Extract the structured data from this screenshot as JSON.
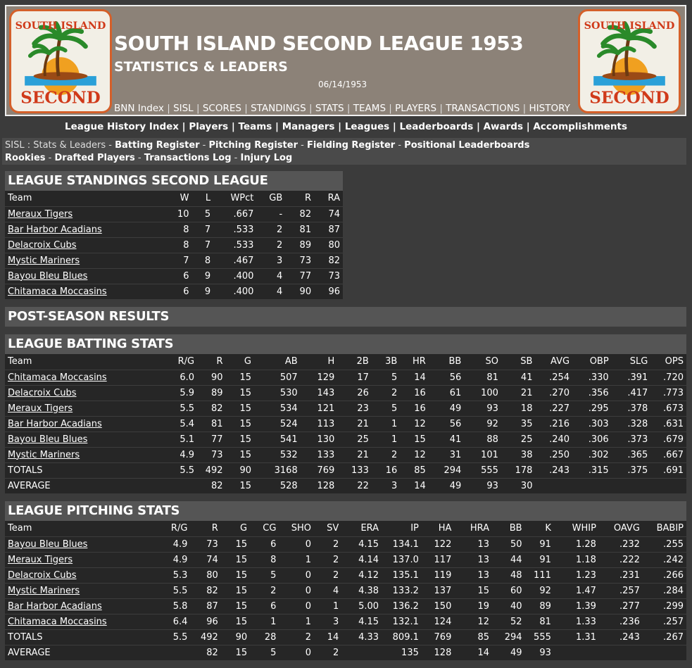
{
  "header": {
    "title": "SOUTH ISLAND SECOND LEAGUE 1953",
    "subtitle": "STATISTICS & LEADERS",
    "date": "06/14/1953",
    "logo_top_text": "SOUTH ISLAND",
    "logo_bottom_text": "SECOND",
    "nav": [
      "BNN Index",
      "SISL",
      "SCORES",
      "STANDINGS",
      "STATS",
      "TEAMS",
      "PLAYERS",
      "TRANSACTIONS",
      "HISTORY"
    ]
  },
  "history_nav": [
    "League History Index",
    "Players",
    "Teams",
    "Managers",
    "Leagues",
    "Leaderboards",
    "Awards",
    "Accomplishments"
  ],
  "stats_nav": {
    "prefix": "SISL : Stats & Leaders - ",
    "links": [
      "Batting Register",
      "Pitching Register",
      "Fielding Register",
      "Positional Leaderboards",
      "Rookies",
      "Drafted Players",
      "Transactions Log",
      "Injury Log"
    ]
  },
  "standings": {
    "title": "LEAGUE STANDINGS SECOND LEAGUE",
    "columns": [
      "Team",
      "W",
      "L",
      "WPct",
      "GB",
      "R",
      "RA"
    ],
    "rows": [
      [
        "Meraux Tigers",
        "10",
        "5",
        ".667",
        "-",
        "82",
        "74"
      ],
      [
        "Bar Harbor Acadians",
        "8",
        "7",
        ".533",
        "2",
        "81",
        "87"
      ],
      [
        "Delacroix Cubs",
        "8",
        "7",
        ".533",
        "2",
        "89",
        "80"
      ],
      [
        "Mystic Mariners",
        "7",
        "8",
        ".467",
        "3",
        "73",
        "82"
      ],
      [
        "Bayou Bleu Blues",
        "6",
        "9",
        ".400",
        "4",
        "77",
        "73"
      ],
      [
        "Chitamaca Moccasins",
        "6",
        "9",
        ".400",
        "4",
        "90",
        "96"
      ]
    ]
  },
  "postseason": {
    "title": "POST-SEASON RESULTS"
  },
  "batting": {
    "title": "LEAGUE BATTING STATS",
    "columns": [
      "Team",
      "R/G",
      "R",
      "G",
      "AB",
      "H",
      "2B",
      "3B",
      "HR",
      "BB",
      "SO",
      "SB",
      "AVG",
      "OBP",
      "SLG",
      "OPS"
    ],
    "rows": [
      [
        "Chitamaca Moccasins",
        "6.0",
        "90",
        "15",
        "507",
        "129",
        "17",
        "5",
        "14",
        "56",
        "81",
        "41",
        ".254",
        ".330",
        ".391",
        ".720"
      ],
      [
        "Delacroix Cubs",
        "5.9",
        "89",
        "15",
        "530",
        "143",
        "26",
        "2",
        "16",
        "61",
        "100",
        "21",
        ".270",
        ".356",
        ".417",
        ".773"
      ],
      [
        "Meraux Tigers",
        "5.5",
        "82",
        "15",
        "534",
        "121",
        "23",
        "5",
        "16",
        "49",
        "93",
        "18",
        ".227",
        ".295",
        ".378",
        ".673"
      ],
      [
        "Bar Harbor Acadians",
        "5.4",
        "81",
        "15",
        "524",
        "113",
        "21",
        "1",
        "12",
        "56",
        "92",
        "35",
        ".216",
        ".303",
        ".328",
        ".631"
      ],
      [
        "Bayou Bleu Blues",
        "5.1",
        "77",
        "15",
        "541",
        "130",
        "25",
        "1",
        "15",
        "41",
        "88",
        "25",
        ".240",
        ".306",
        ".373",
        ".679"
      ],
      [
        "Mystic Mariners",
        "4.9",
        "73",
        "15",
        "532",
        "133",
        "21",
        "2",
        "12",
        "31",
        "101",
        "38",
        ".250",
        ".302",
        ".365",
        ".667"
      ]
    ],
    "totals": [
      "TOTALS",
      "5.5",
      "492",
      "90",
      "3168",
      "769",
      "133",
      "16",
      "85",
      "294",
      "555",
      "178",
      ".243",
      ".315",
      ".375",
      ".691"
    ],
    "average": [
      "AVERAGE",
      "",
      "82",
      "15",
      "528",
      "128",
      "22",
      "3",
      "14",
      "49",
      "93",
      "30",
      "",
      "",
      "",
      ""
    ]
  },
  "pitching": {
    "title": "LEAGUE PITCHING STATS",
    "columns": [
      "Team",
      "R/G",
      "R",
      "G",
      "CG",
      "SHO",
      "SV",
      "ERA",
      "IP",
      "HA",
      "HRA",
      "BB",
      "K",
      "WHIP",
      "OAVG",
      "BABIP"
    ],
    "rows": [
      [
        "Bayou Bleu Blues",
        "4.9",
        "73",
        "15",
        "6",
        "0",
        "2",
        "4.15",
        "134.1",
        "122",
        "13",
        "50",
        "91",
        "1.28",
        ".232",
        ".255"
      ],
      [
        "Meraux Tigers",
        "4.9",
        "74",
        "15",
        "8",
        "1",
        "2",
        "4.14",
        "137.0",
        "117",
        "13",
        "44",
        "91",
        "1.18",
        ".222",
        ".242"
      ],
      [
        "Delacroix Cubs",
        "5.3",
        "80",
        "15",
        "5",
        "0",
        "2",
        "4.12",
        "135.1",
        "119",
        "13",
        "48",
        "111",
        "1.23",
        ".231",
        ".266"
      ],
      [
        "Mystic Mariners",
        "5.5",
        "82",
        "15",
        "2",
        "0",
        "4",
        "4.38",
        "133.2",
        "137",
        "15",
        "60",
        "92",
        "1.47",
        ".257",
        ".284"
      ],
      [
        "Bar Harbor Acadians",
        "5.8",
        "87",
        "15",
        "6",
        "0",
        "1",
        "5.00",
        "136.2",
        "150",
        "19",
        "40",
        "89",
        "1.39",
        ".277",
        ".299"
      ],
      [
        "Chitamaca Moccasins",
        "6.4",
        "96",
        "15",
        "1",
        "1",
        "3",
        "4.15",
        "132.1",
        "124",
        "12",
        "52",
        "81",
        "1.33",
        ".236",
        ".257"
      ]
    ],
    "totals": [
      "TOTALS",
      "5.5",
      "492",
      "90",
      "28",
      "2",
      "14",
      "4.33",
      "809.1",
      "769",
      "85",
      "294",
      "555",
      "1.31",
      ".243",
      ".267"
    ],
    "average": [
      "AVERAGE",
      "",
      "82",
      "15",
      "5",
      "0",
      "2",
      "",
      "135",
      "128",
      "14",
      "49",
      "93",
      "",
      "",
      ""
    ]
  }
}
